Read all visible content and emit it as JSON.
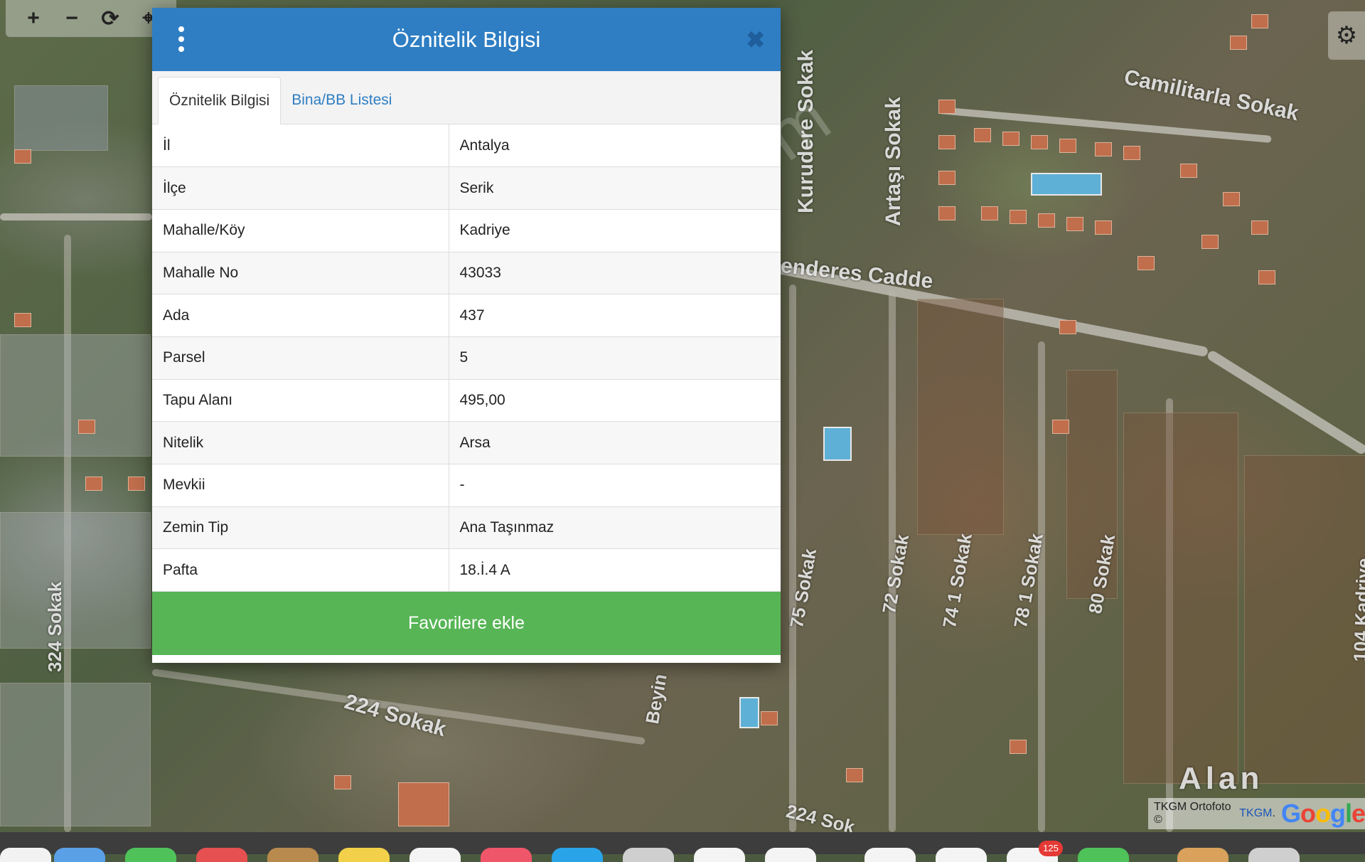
{
  "map": {
    "street_labels": [
      "Camilitarla Sokak",
      "Kurudere Sokak",
      "Artaşı Sokak",
      "enderes Cadde",
      "224 Sokak",
      "324 Sokak",
      "72 Sokak",
      "74 1 Sokak",
      "78 1 Sokak",
      "80 Sokak",
      "104 Kadriye",
      "Beyin",
      "Alan",
      "224 Sok",
      "75 Sokak"
    ],
    "watermark": "emlakjet.com",
    "attribution": {
      "text": "TKGM Ortofoto ©",
      "link": "TKGM",
      "suffix": ".",
      "google": "Google"
    }
  },
  "toolbar": {
    "zoom_in": "+",
    "zoom_out": "−",
    "refresh": "⟳",
    "locate": "⌖"
  },
  "settings_icon": "⚙",
  "dialog": {
    "title": "Öznitelik Bilgisi",
    "close": "✖",
    "tabs": [
      {
        "label": "Öznitelik Bilgisi",
        "active": true
      },
      {
        "label": "Bina/BB Listesi",
        "active": false
      }
    ],
    "rows": [
      {
        "key": "İl",
        "value": "Antalya"
      },
      {
        "key": "İlçe",
        "value": "Serik"
      },
      {
        "key": "Mahalle/Köy",
        "value": "Kadriye"
      },
      {
        "key": "Mahalle No",
        "value": "43033"
      },
      {
        "key": "Ada",
        "value": "437"
      },
      {
        "key": "Parsel",
        "value": "5"
      },
      {
        "key": "Tapu Alanı",
        "value": "495,00"
      },
      {
        "key": "Nitelik",
        "value": "Arsa"
      },
      {
        "key": "Mevkii",
        "value": "-"
      },
      {
        "key": "Zemin Tip",
        "value": "Ana Taşınmaz"
      },
      {
        "key": "Pafta",
        "value": "18.İ.4 A"
      }
    ],
    "favorite_button": "Favorilere ekle"
  },
  "dock": {
    "badge": "125"
  },
  "colors": {
    "header_blue": "#2f7ec3",
    "button_green": "#57b556",
    "tab_link": "#2f7ec3"
  }
}
